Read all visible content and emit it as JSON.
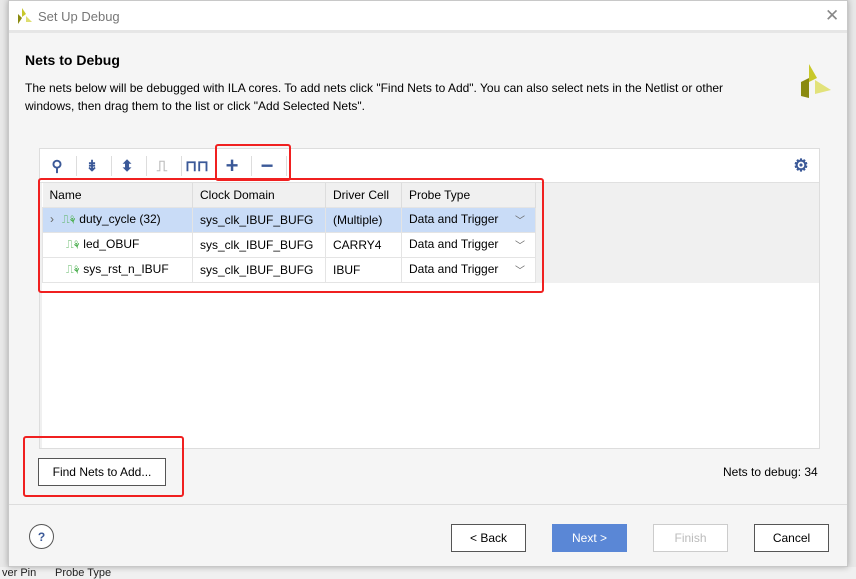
{
  "window": {
    "title": "Set Up Debug",
    "close_icon": "close-icon"
  },
  "page": {
    "heading": "Nets to Debug",
    "description": "The nets below will be debugged with ILA cores. To add nets click \"Find Nets to Add\". You can also select nets in the Netlist or other windows, then drag them to the list or click \"Add Selected Nets\"."
  },
  "toolbar": {
    "icons": [
      "search-icon",
      "collapse-all-icon",
      "expand-all-icon",
      "signal-icon",
      "waveform-icon",
      "add-icon",
      "remove-icon",
      "gear-icon"
    ]
  },
  "table": {
    "columns": [
      "Name",
      "Clock Domain",
      "Driver Cell",
      "Probe Type"
    ],
    "rows": [
      {
        "name": "duty_cycle (32)",
        "clock": "sys_clk_IBUF_BUFG",
        "driver": "(Multiple)",
        "probe": "Data and Trigger",
        "expandable": true,
        "selected": true
      },
      {
        "name": "led_OBUF",
        "clock": "sys_clk_IBUF_BUFG",
        "driver": "CARRY4",
        "probe": "Data and Trigger"
      },
      {
        "name": "sys_rst_n_IBUF",
        "clock": "sys_clk_IBUF_BUFG",
        "driver": "IBUF",
        "probe": "Data and Trigger"
      }
    ]
  },
  "find_button": "Find Nets to Add...",
  "nets_count": "Nets to debug: 34",
  "footer": {
    "help": "?",
    "back": "< Back",
    "next": "Next >",
    "finish": "Finish",
    "cancel": "Cancel"
  },
  "background": {
    "columns": [
      "ver Pin",
      "Probe Type"
    ]
  },
  "colors": {
    "accent": "#5a87d6",
    "highlight": "#f02020",
    "selected_row": "#c9dcf7"
  }
}
